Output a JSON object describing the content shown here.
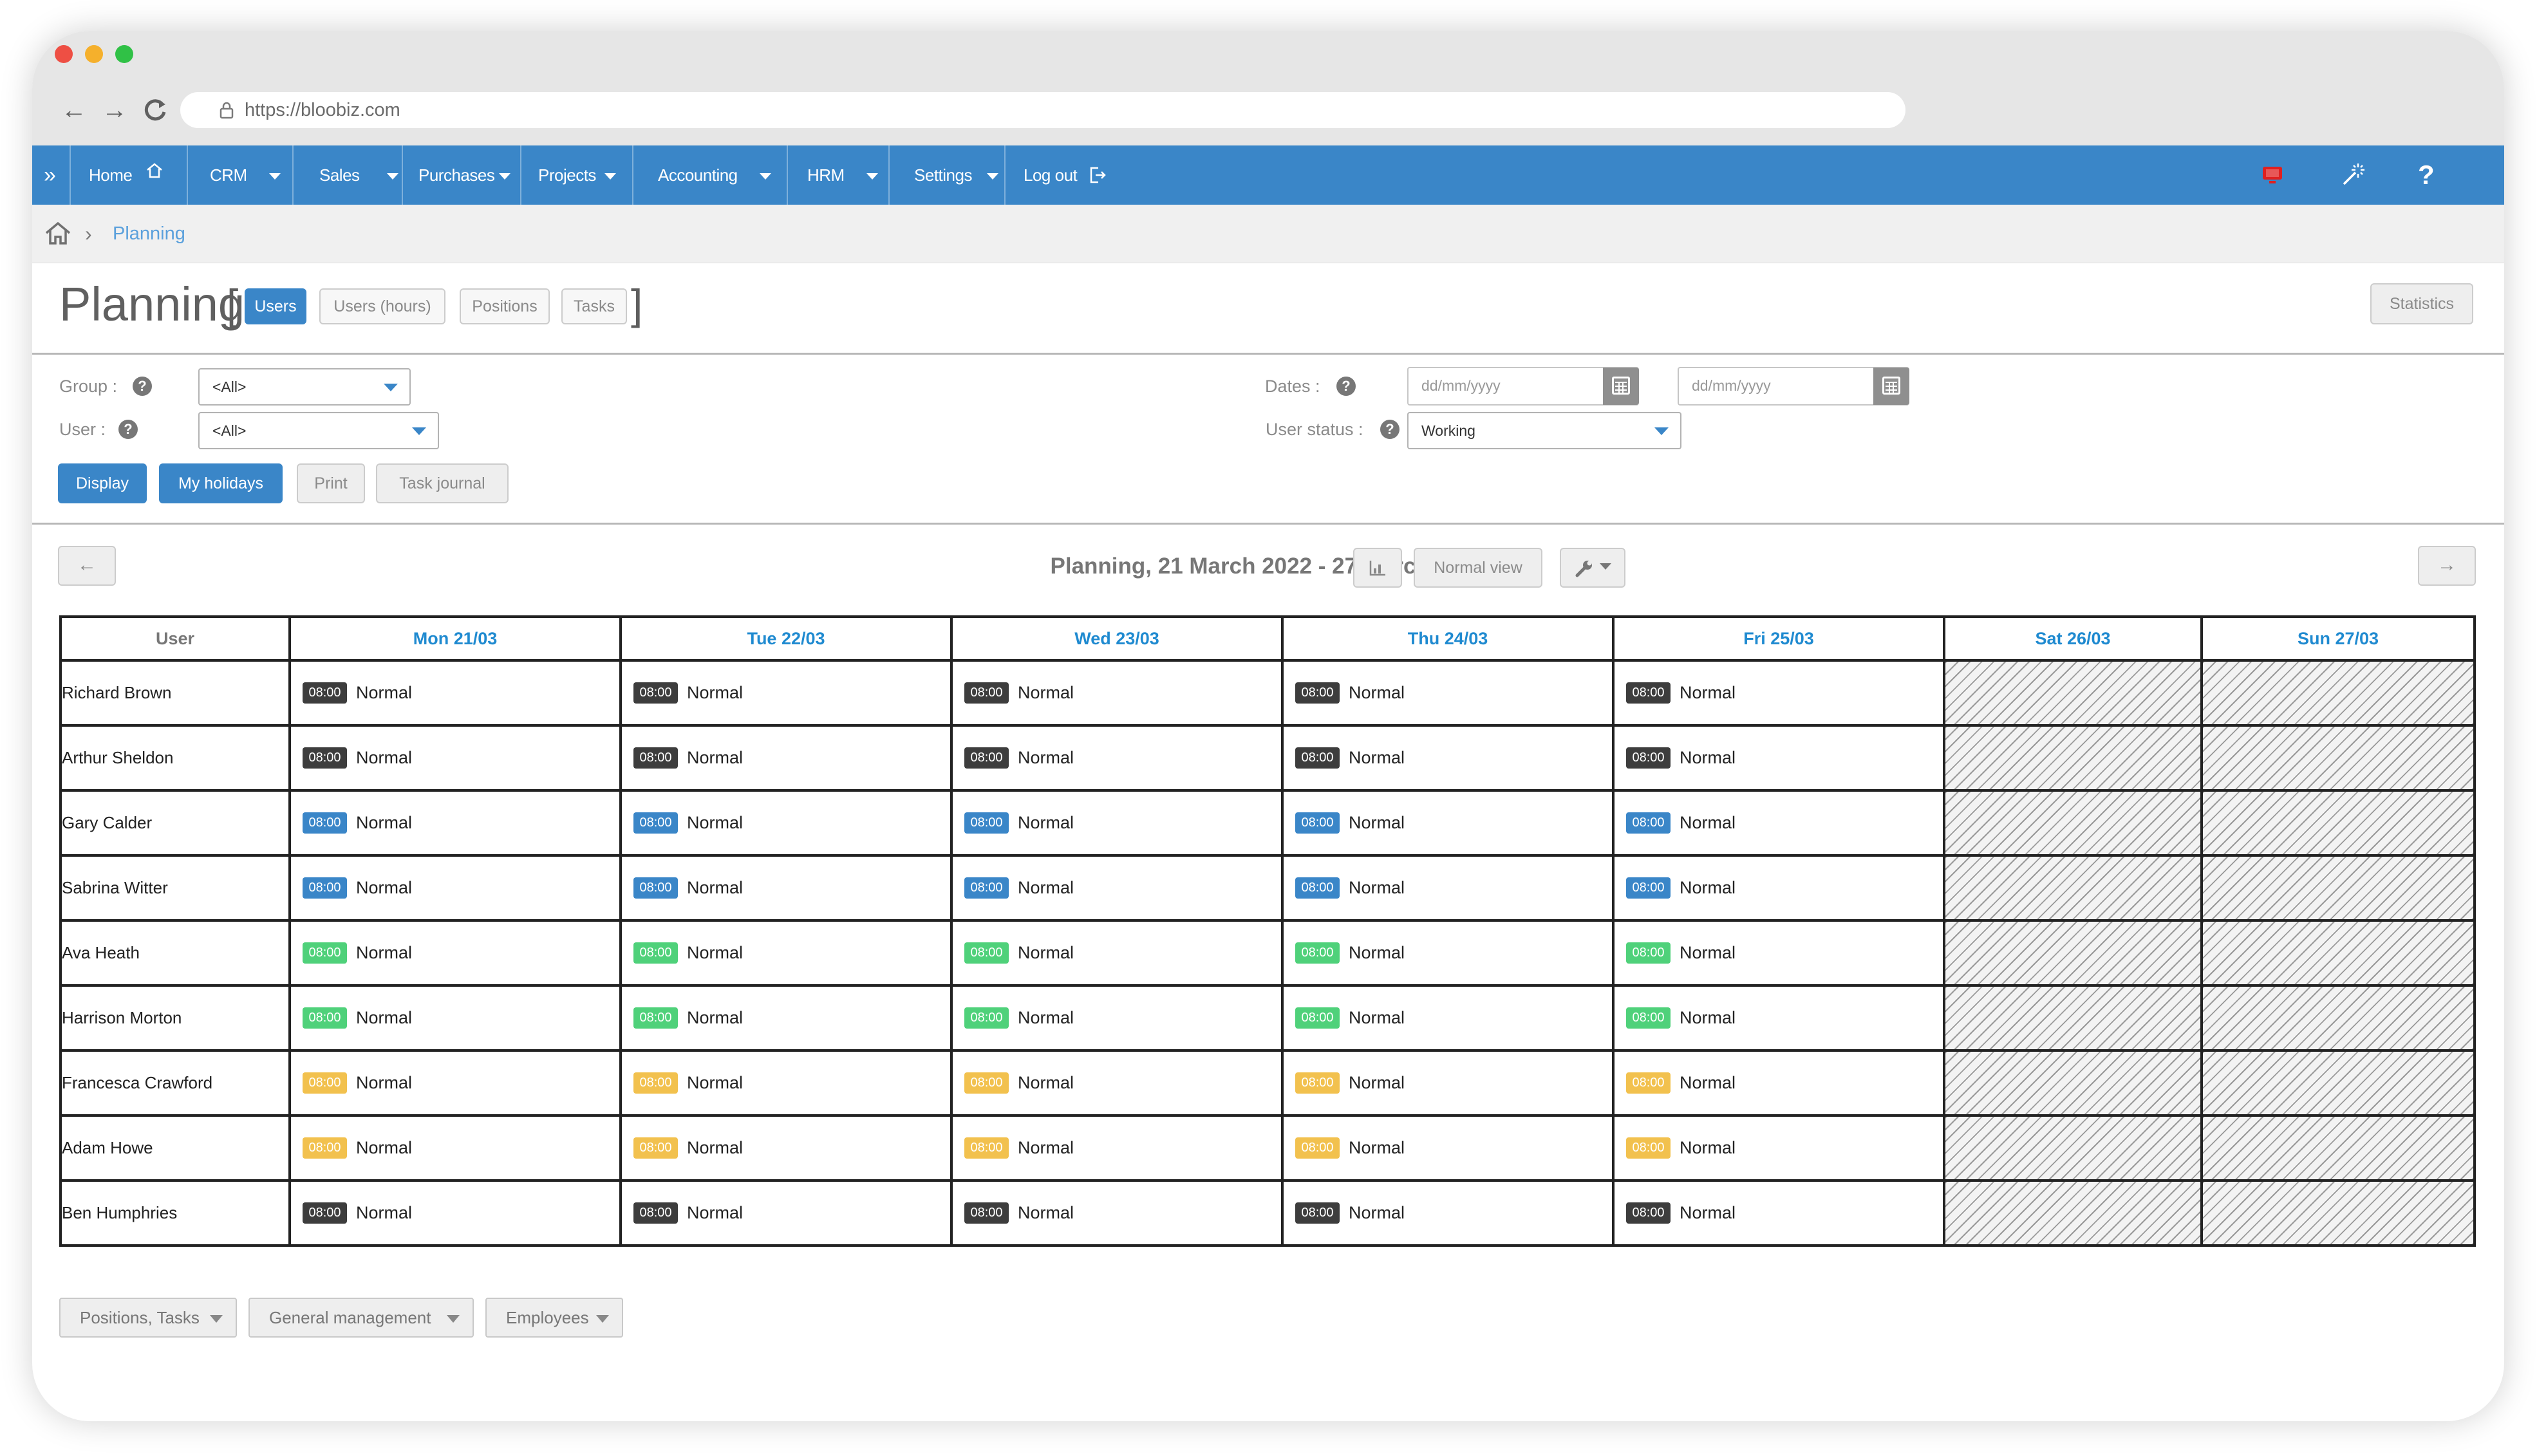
{
  "browser": {
    "url": "https://bloobiz.com"
  },
  "menu": {
    "items": [
      {
        "label": "Home"
      },
      {
        "label": "CRM"
      },
      {
        "label": "Sales"
      },
      {
        "label": "Purchases"
      },
      {
        "label": "Projects"
      },
      {
        "label": "Accounting"
      },
      {
        "label": "HRM"
      },
      {
        "label": "Settings"
      },
      {
        "label": "Log out"
      }
    ],
    "help_label": "?"
  },
  "breadcrumb": {
    "current": "Planning"
  },
  "page": {
    "title": "Planning",
    "tabs": [
      {
        "label": "Users",
        "active": true
      },
      {
        "label": "Users (hours)"
      },
      {
        "label": "Positions"
      },
      {
        "label": "Tasks"
      }
    ],
    "statistics_label": "Statistics"
  },
  "filters": {
    "group_label": "Group :",
    "group_value": "<All>",
    "user_label": "User :",
    "user_value": "<All>",
    "dates_label": "Dates :",
    "date_from_placeholder": "dd/mm/yyyy",
    "date_to_placeholder": "dd/mm/yyyy",
    "status_label": "User status :",
    "status_value": "Working",
    "help_mark": "?"
  },
  "actions": {
    "display": "Display",
    "my_holidays": "My holidays",
    "print": "Print",
    "task_journal": "Task journal"
  },
  "planning": {
    "period_title": "Planning, 21 March 2022 - 27 March 2022",
    "normal_view": "Normal view",
    "prev_icon": "arrow-left-icon",
    "next_icon": "arrow-right-icon",
    "user_header": "User",
    "days": [
      "Mon 21/03",
      "Tue 22/03",
      "Wed 23/03",
      "Thu 24/03",
      "Fri 25/03",
      "Sat 26/03",
      "Sun 27/03"
    ],
    "weekend_days": [
      5,
      6
    ],
    "colors": {
      "dark": "#3d3d3d",
      "blue": "#3a86c8",
      "green": "#4fd17a",
      "yellow": "#f2c14e"
    },
    "rows": [
      {
        "name": "Richard Brown",
        "color": "dark"
      },
      {
        "name": "Arthur Sheldon",
        "color": "dark"
      },
      {
        "name": "Gary Calder",
        "color": "blue"
      },
      {
        "name": "Sabrina Witter",
        "color": "blue"
      },
      {
        "name": "Ava Heath",
        "color": "green"
      },
      {
        "name": "Harrison Morton",
        "color": "green"
      },
      {
        "name": "Francesca Crawford",
        "color": "yellow"
      },
      {
        "name": "Adam Howe",
        "color": "yellow"
      },
      {
        "name": "Ben Humphries",
        "color": "dark"
      }
    ],
    "shift_time": "08:00",
    "shift_label": "Normal"
  },
  "footer_menus": [
    {
      "label": "Positions, Tasks"
    },
    {
      "label": "General management"
    },
    {
      "label": "Employees"
    }
  ]
}
